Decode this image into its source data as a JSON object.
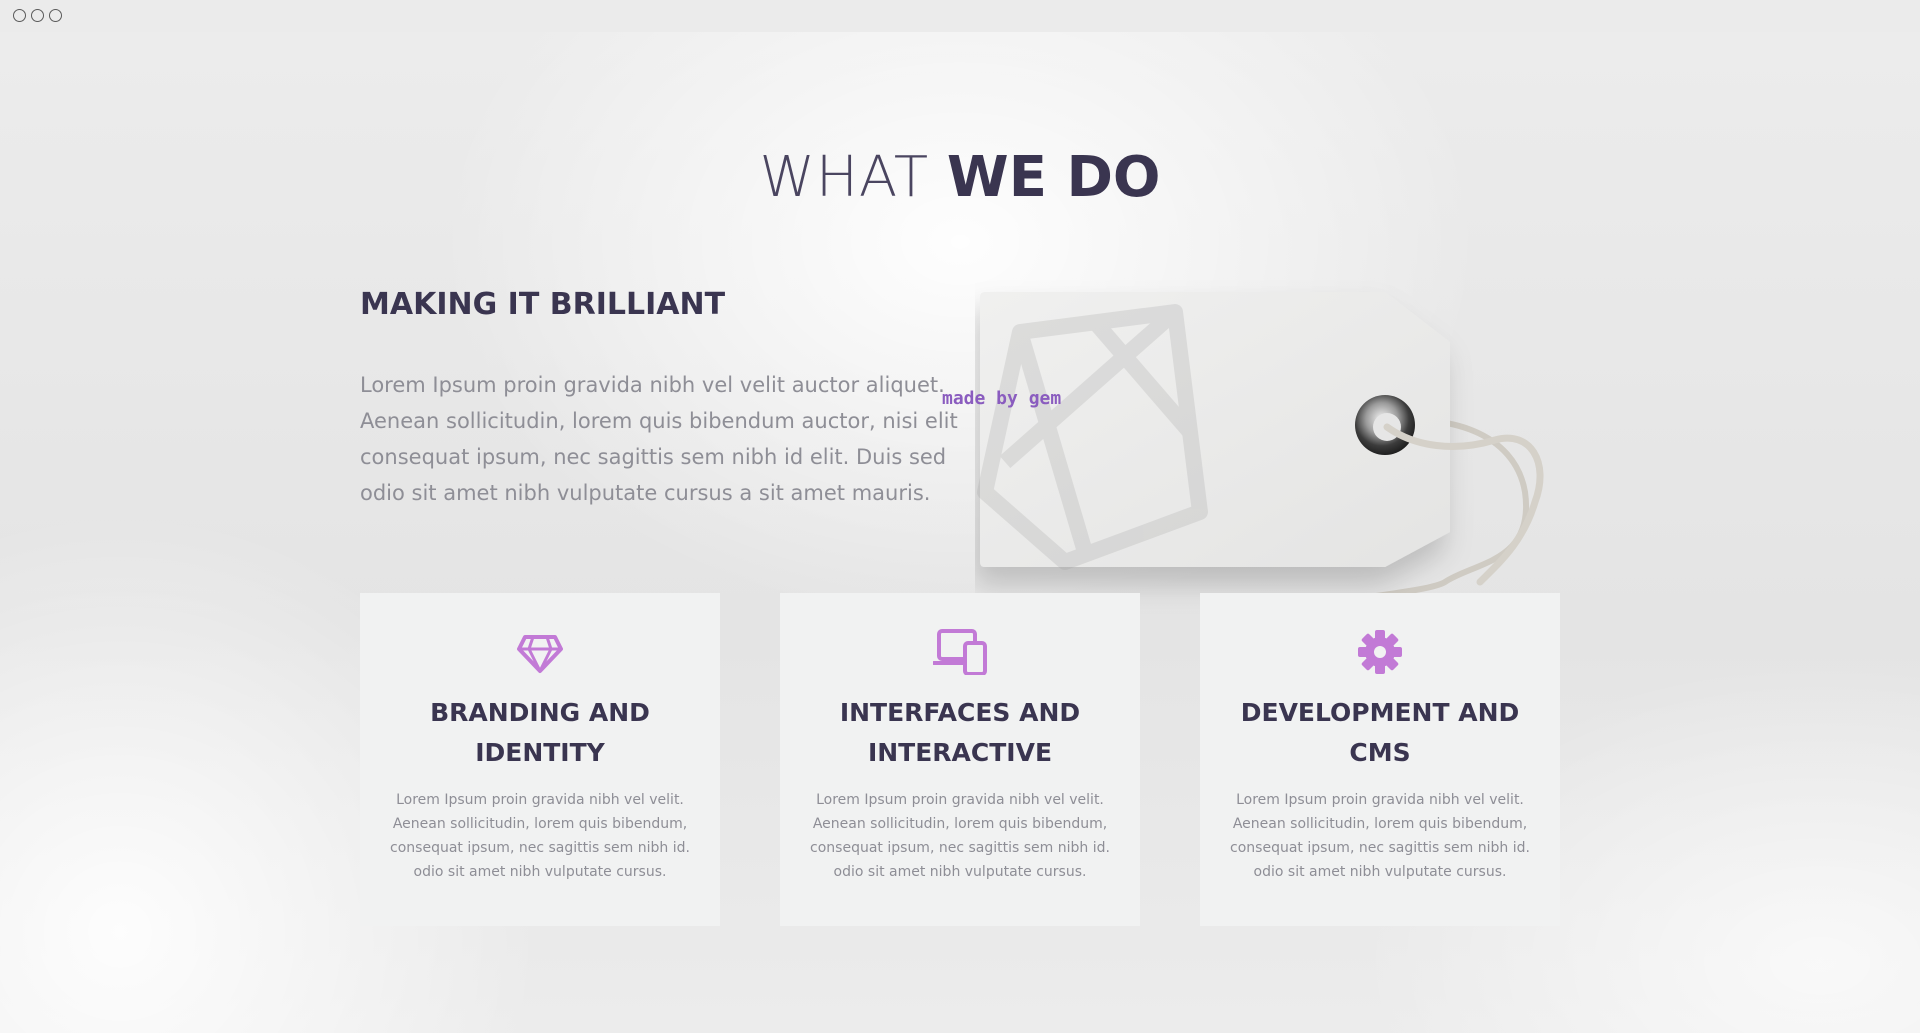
{
  "window": {
    "controls": [
      "close",
      "minimize",
      "maximize"
    ]
  },
  "section": {
    "heading_light": "WHAT",
    "heading_bold": "WE DO"
  },
  "intro": {
    "title": "MAKING IT BRILLIANT",
    "paragraph": "Lorem Ipsum proin gravida nibh vel velit auctor aliquet. Aenean sollicitudin, lorem quis bibendum auctor, nisi elit consequat ipsum, nec sagittis sem nibh id elit. Duis sed odio sit amet nibh vulputate cursus a sit amet mauris."
  },
  "tag": {
    "label": "made by gem",
    "icon": "gem-logo"
  },
  "services": [
    {
      "icon": "diamond-icon",
      "title": "BRANDING AND IDENTITY",
      "text": "Lorem Ipsum proin gravida nibh vel velit. Aenean sollicitudin, lorem quis bibendum, consequat ipsum, nec sagittis sem nibh id. odio sit amet nibh vulputate cursus."
    },
    {
      "icon": "devices-icon",
      "title": "INTERFACES AND INTERACTIVE",
      "text": "Lorem Ipsum proin gravida nibh vel velit. Aenean sollicitudin, lorem quis bibendum, consequat ipsum, nec sagittis sem nibh id. odio sit amet nibh vulputate cursus."
    },
    {
      "icon": "gear-icon",
      "title": "DEVELOPMENT AND CMS",
      "text": "Lorem Ipsum proin gravida nibh vel velit. Aenean sollicitudin, lorem quis bibendum, consequat ipsum, nec sagittis sem nibh id. odio sit amet nibh vulputate cursus."
    }
  ],
  "colors": {
    "heading": "#3a3550",
    "body_text": "#8e8e96",
    "accent": "#c27ad6",
    "tag_label": "#8a5cbf",
    "card_bg": "#f1f2f2"
  }
}
